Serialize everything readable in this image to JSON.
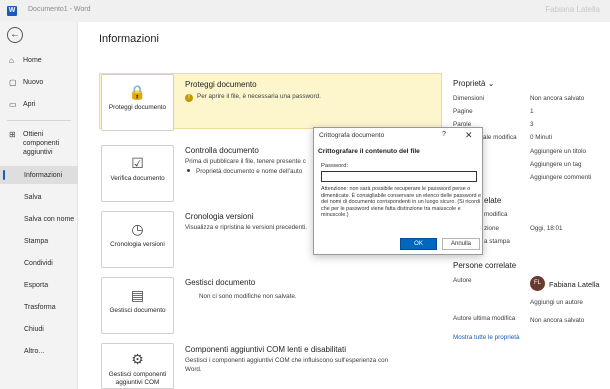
{
  "window": {
    "app_icon": "W",
    "doc_title": "Documento1  -  Word",
    "user_name": "Fabiana Latella"
  },
  "nav": {
    "items": [
      {
        "icon": "⌂",
        "label": "Home"
      },
      {
        "icon": "▢",
        "label": "Nuovo"
      },
      {
        "icon": "▭",
        "label": "Apri"
      },
      {
        "icon": "⊞",
        "label": "Ottieni componenti aggiuntivi"
      },
      {
        "label": "Informazioni"
      },
      {
        "label": "Salva"
      },
      {
        "label": "Salva con nome"
      },
      {
        "label": "Stampa"
      },
      {
        "label": "Condividi"
      },
      {
        "label": "Esporta"
      },
      {
        "label": "Trasforma"
      },
      {
        "label": "Chiudi"
      },
      {
        "label": "Altro..."
      }
    ]
  },
  "page_title": "Informazioni",
  "sections": {
    "protect": {
      "button": "Proteggi documento",
      "title": "Proteggi documento",
      "text": "Per aprire il file, è necessaria una password."
    },
    "inspect": {
      "button": "Verifica documento",
      "title": "Controlla documento",
      "line1": "Prima di pubblicare il file, tenere presente c",
      "line2": "Proprietà documento e nome dell'auto"
    },
    "history": {
      "button": "Cronologia versioni",
      "title": "Cronologia versioni",
      "text": "Visualizza e ripristina le versioni precedenti."
    },
    "manage": {
      "button": "Gestisci documento",
      "title": "Gestisci documento",
      "text": "Non ci sono modifiche non salvate."
    },
    "com": {
      "button": "Gestisci componenti aggiuntivi COM",
      "title": "Componenti aggiuntivi COM lenti e disabilitati",
      "line1": "Gestisci i componenti aggiuntivi COM che influiscono sull'esperienza con",
      "line2": "Word."
    }
  },
  "properties": {
    "title": "Proprietà",
    "rows": [
      {
        "key": "Dimensioni",
        "value": "Non ancora salvato"
      },
      {
        "key": "Pagine",
        "value": "1"
      },
      {
        "key": "Parole",
        "value": "3"
      },
      {
        "key": "ale modifica",
        "value": "0 Minuti"
      },
      {
        "key": "",
        "value": "Aggiungere un titolo"
      },
      {
        "key": "",
        "value": "Aggiungere un tag"
      },
      {
        "key": "",
        "value": "Aggiungere commenti"
      }
    ],
    "related_dates_title": "elate",
    "modified_label": "modifica",
    "created_label": "zione",
    "created_value": "Oggi, 18:01",
    "printed_label": "a stampa",
    "related_people_title": "Persone correlate",
    "author_label": "Autore",
    "author_initials": "FL",
    "author_name": "Fabiana Latella",
    "add_author": "Aggiungi un autore",
    "last_modified_by_label": "Autore ultima modifica",
    "last_modified_by_value": "Non ancora salvato",
    "show_all": "Mostra tutte le proprietà"
  },
  "dialog": {
    "title": "Crittografa documento",
    "help": "?",
    "close": "✕",
    "heading": "Crittografare il contenuto del file",
    "password_label": "Password:",
    "password_value": "",
    "note": "Attenzione: non sarà possibile recuperare le password perse o dimenticate. È consigliabile conservare un elenco delle password e dei nomi di documento corrispondenti in un luogo sicuro. (Si ricordi che per le password viene fatta distinzione tra maiuscole e minuscole.)",
    "ok": "OK",
    "cancel": "Annulla"
  },
  "colors": {
    "accent": "#185abd",
    "protect_band": "#fdf6cc",
    "ok_button": "#0067c0"
  },
  "icons": {
    "back": "←",
    "protect": "🔒",
    "inspect": "☑",
    "history": "◷",
    "manage": "▤",
    "com": "⚙",
    "warning": "!"
  }
}
